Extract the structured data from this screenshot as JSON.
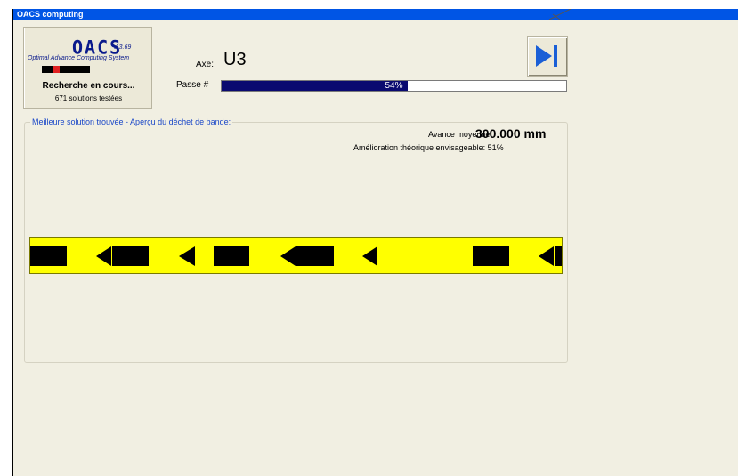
{
  "window": {
    "title": "OACS computing"
  },
  "logo": {
    "mark": "OACS",
    "version": "V 3.69",
    "tagline": "Optimal Advance Computing System"
  },
  "status": {
    "main": "Recherche en cours...",
    "sub": "671 solutions testées"
  },
  "axe": {
    "label": "Axe:",
    "value": "U3"
  },
  "pass": {
    "label": "Passe #",
    "progress_text": "54%",
    "progress_value": 0.54
  },
  "buttons": {
    "skip_icon": "skip-to-end-icon"
  },
  "result": {
    "legend": "Meilleure solution trouvée - Aperçu du déchet de bande:",
    "avance_label": "Avance moyenne:",
    "avance_value": "300.000 mm",
    "amelioration": "Amélioration théorique envisageable: 51%"
  },
  "colors": {
    "titlebar": "#0055e5",
    "progress_fill": "#0a0a70",
    "strip_background": "#ffff00",
    "strip_shapes": "#000000",
    "accent_legend": "#1a47c8"
  }
}
